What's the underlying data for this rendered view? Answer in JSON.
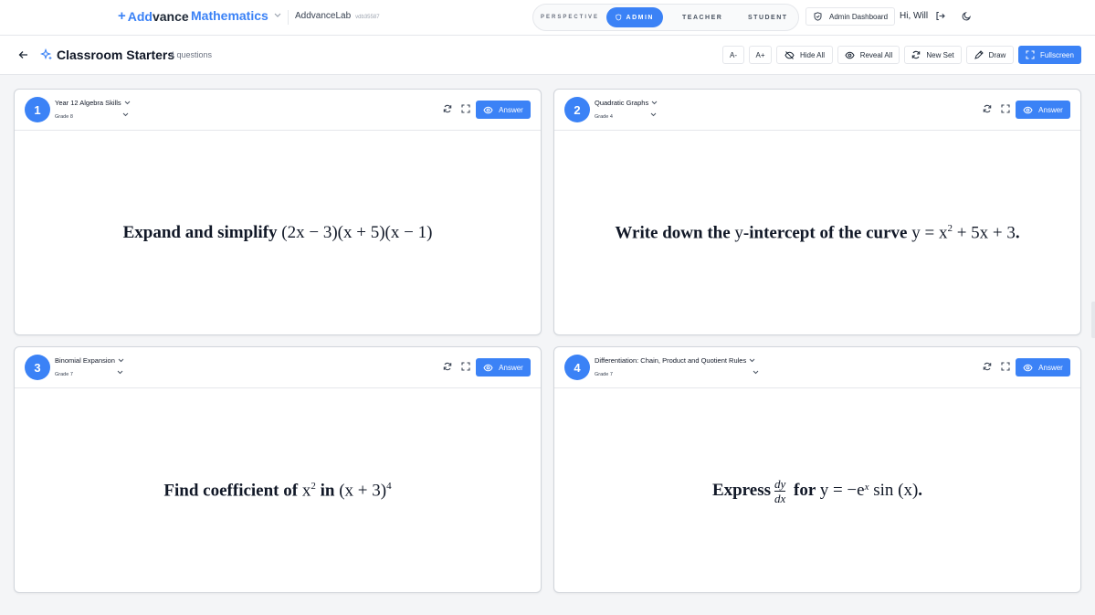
{
  "nav": {
    "brand_plus": "+",
    "brand_a": "Add",
    "brand_b": "vance",
    "subject": "Mathematics",
    "lab": "AddvanceLab",
    "version": "vdb35587",
    "perspective_label": "PERSPECTIVE",
    "perspectives": [
      {
        "label": "ADMIN",
        "active": true
      },
      {
        "label": "TEACHER",
        "active": false
      },
      {
        "label": "STUDENT",
        "active": false
      }
    ],
    "admin_dashboard": "Admin Dashboard",
    "greeting": "Hi, Will"
  },
  "subbar": {
    "title": "Classroom Starters",
    "count": "4 questions",
    "buttons": {
      "font_down": "A-",
      "font_up": "A+",
      "hide_all": "Hide All",
      "reveal_all": "Reveal All",
      "new_set": "New Set",
      "draw": "Draw",
      "fullscreen": "Fullscreen"
    }
  },
  "cards": [
    {
      "number": "1",
      "topic": "Year 12 Algebra Skills",
      "grade": "Grade 8",
      "answer_label": "Answer",
      "q": {
        "t1": "Expand and simplify ",
        "m1": "(2",
        "v1": "x",
        "m2": " − 3)(",
        "v2": "x",
        "m3": " + 5)(",
        "v3": "x",
        "m4": " − 1)"
      }
    },
    {
      "number": "2",
      "topic": "Quadratic Graphs",
      "grade": "Grade 4",
      "answer_label": "Answer",
      "q": {
        "t1": "Write down the ",
        "v1": "y",
        "t2": "-intercept of the curve ",
        "v2": "y",
        "m1": " = ",
        "v3": "x",
        "sup": "2",
        "m2": " + 5",
        "v4": "x",
        "m3": " + 3",
        "t3": "."
      }
    },
    {
      "number": "3",
      "topic": "Binomial Expansion",
      "grade": "Grade 7",
      "answer_label": "Answer",
      "q": {
        "t1": "Find coefficient of ",
        "v1": "x",
        "sup1": "2",
        "t2": " in ",
        "m1": "(",
        "v2": "x",
        "m2": " + 3)",
        "sup2": "4"
      }
    },
    {
      "number": "4",
      "topic": "Differentiation: Chain, Product and Quotient Rules",
      "grade": "Grade 7",
      "answer_label": "Answer",
      "q": {
        "t1": "Express ",
        "num": "dy",
        "den": "dx",
        "t2": " for ",
        "v1": "y",
        "m1": " = −",
        "v2": "e",
        "sup": "x",
        "m2": " sin (",
        "v3": "x",
        "m3": ")",
        "t3": "."
      }
    }
  ]
}
